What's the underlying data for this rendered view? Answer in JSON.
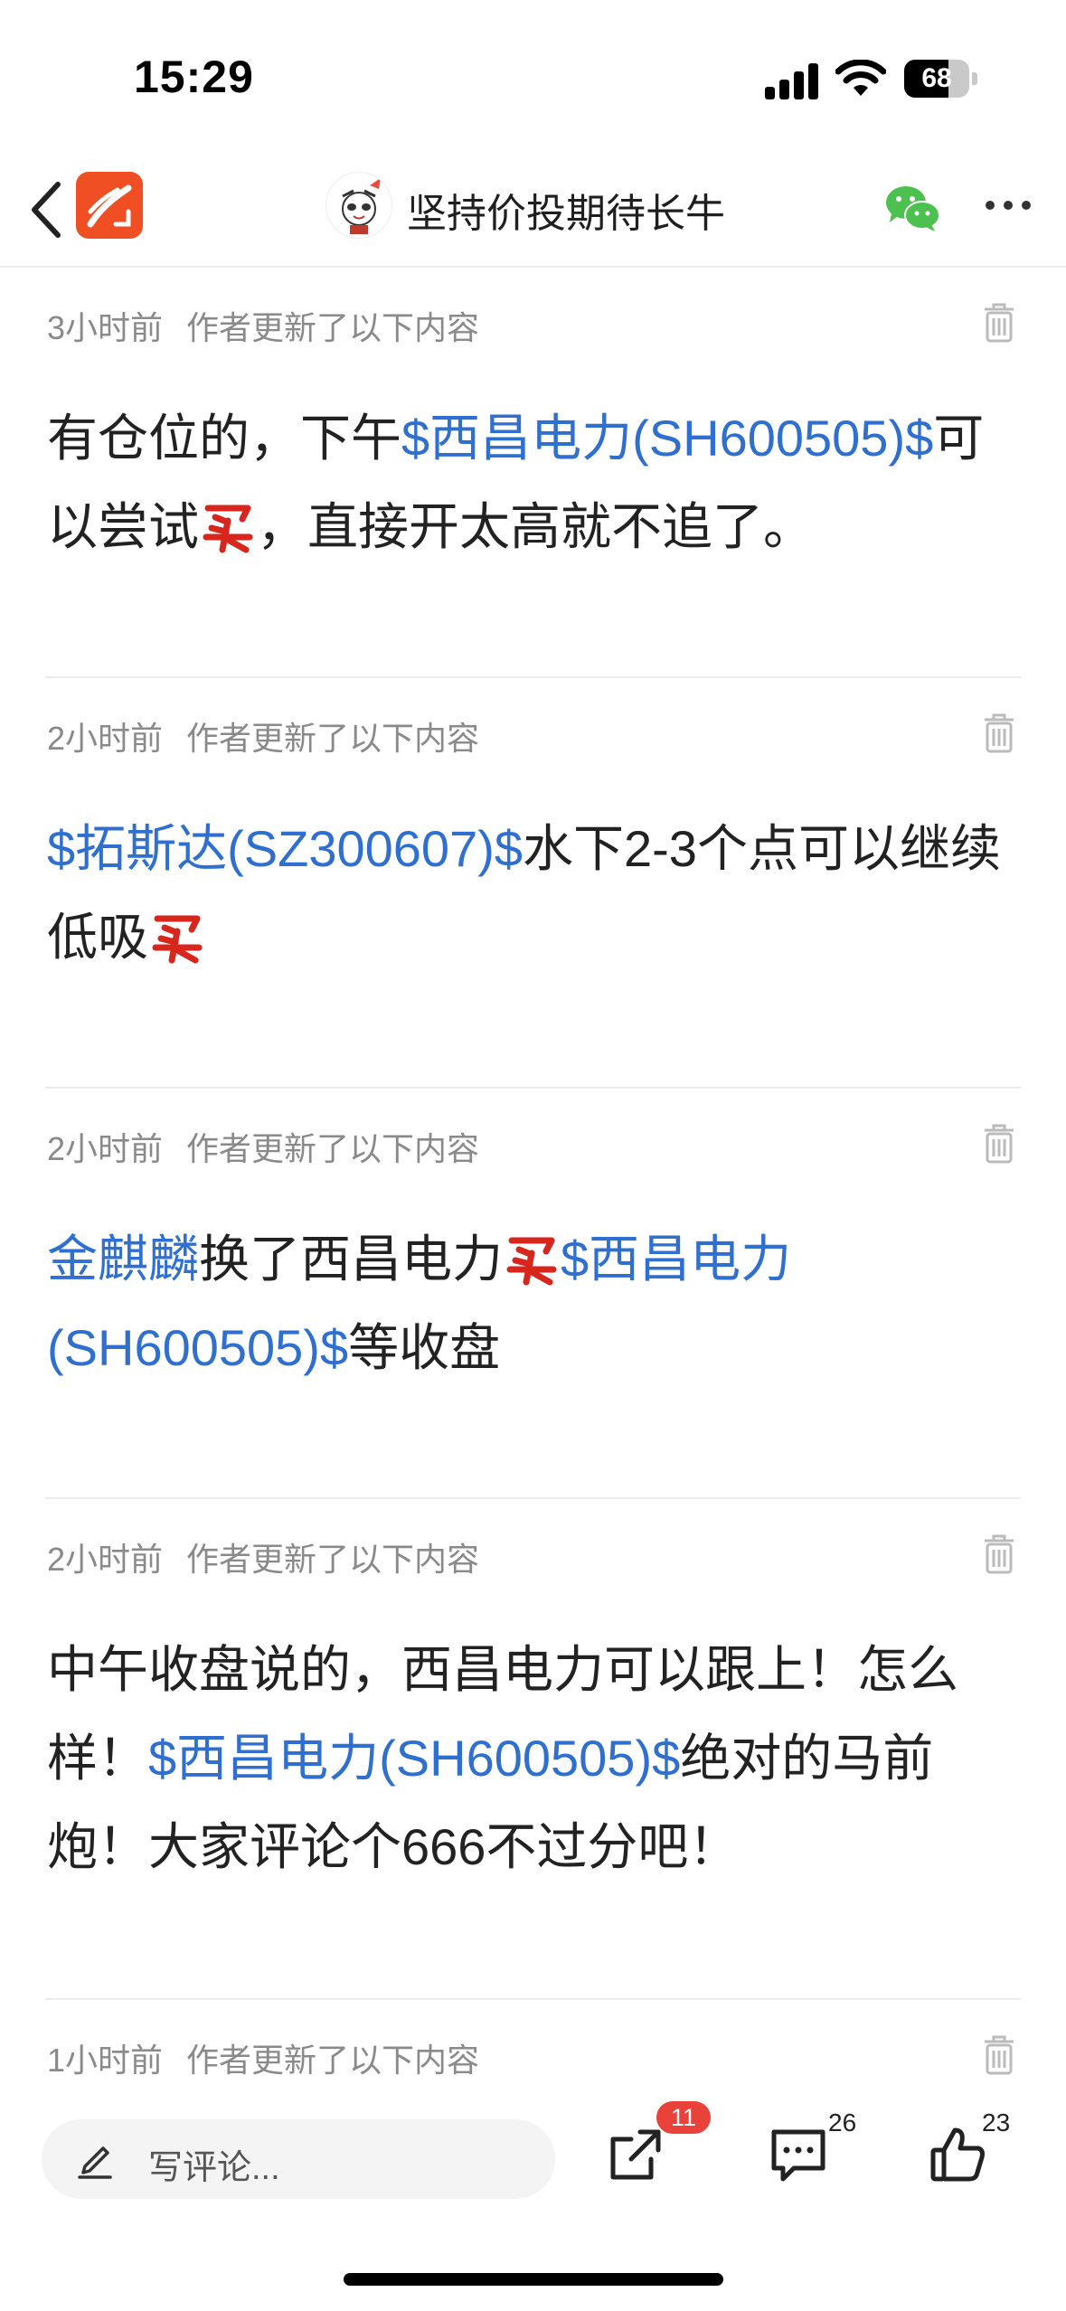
{
  "status_bar": {
    "time": "15:29",
    "battery": "68",
    "battery_level": 0.68
  },
  "nav": {
    "title": "坚持价投期待长牛"
  },
  "posts": [
    {
      "time": "3小时前",
      "meta": "作者更新了以下内容",
      "parts": [
        {
          "type": "text",
          "text": "有仓位的，下午"
        },
        {
          "type": "link",
          "text": "$西昌电力(SH600505)$"
        },
        {
          "type": "text",
          "text": "可以尝试"
        },
        {
          "type": "emoji",
          "name": "buy-emoji"
        },
        {
          "type": "text",
          "text": "，直接开太高就不追了。"
        }
      ]
    },
    {
      "time": "2小时前",
      "meta": "作者更新了以下内容",
      "parts": [
        {
          "type": "link",
          "text": "$拓斯达(SZ300607)$"
        },
        {
          "type": "text",
          "text": "水下2-3个点可以继续低吸"
        },
        {
          "type": "emoji",
          "name": "buy-emoji"
        }
      ]
    },
    {
      "time": "2小时前",
      "meta": "作者更新了以下内容",
      "parts": [
        {
          "type": "link",
          "text": "金麒麟"
        },
        {
          "type": "text",
          "text": "换了西昌电力"
        },
        {
          "type": "emoji",
          "name": "buy-emoji"
        },
        {
          "type": "link",
          "text": "$西昌电力(SH600505)$"
        },
        {
          "type": "text",
          "text": "等收盘"
        }
      ]
    },
    {
      "time": "2小时前",
      "meta": "作者更新了以下内容",
      "parts": [
        {
          "type": "text",
          "text": "中午收盘说的，西昌电力可以跟上！怎么样！"
        },
        {
          "type": "link",
          "text": "$西昌电力(SH600505)$"
        },
        {
          "type": "text",
          "text": "绝对的马前炮！大家评论个666不过分吧！"
        }
      ]
    },
    {
      "time": "1小时前",
      "meta": "作者更新了以下内容",
      "parts": []
    }
  ],
  "bottom": {
    "comment_placeholder": "写评论...",
    "share_badge": "11",
    "comment_count": "26",
    "like_count": "23"
  },
  "colors": {
    "link": "#2f6fd0",
    "brand": "#f04e23",
    "badge": "#e8423a",
    "wechat": "#4cc14f"
  }
}
